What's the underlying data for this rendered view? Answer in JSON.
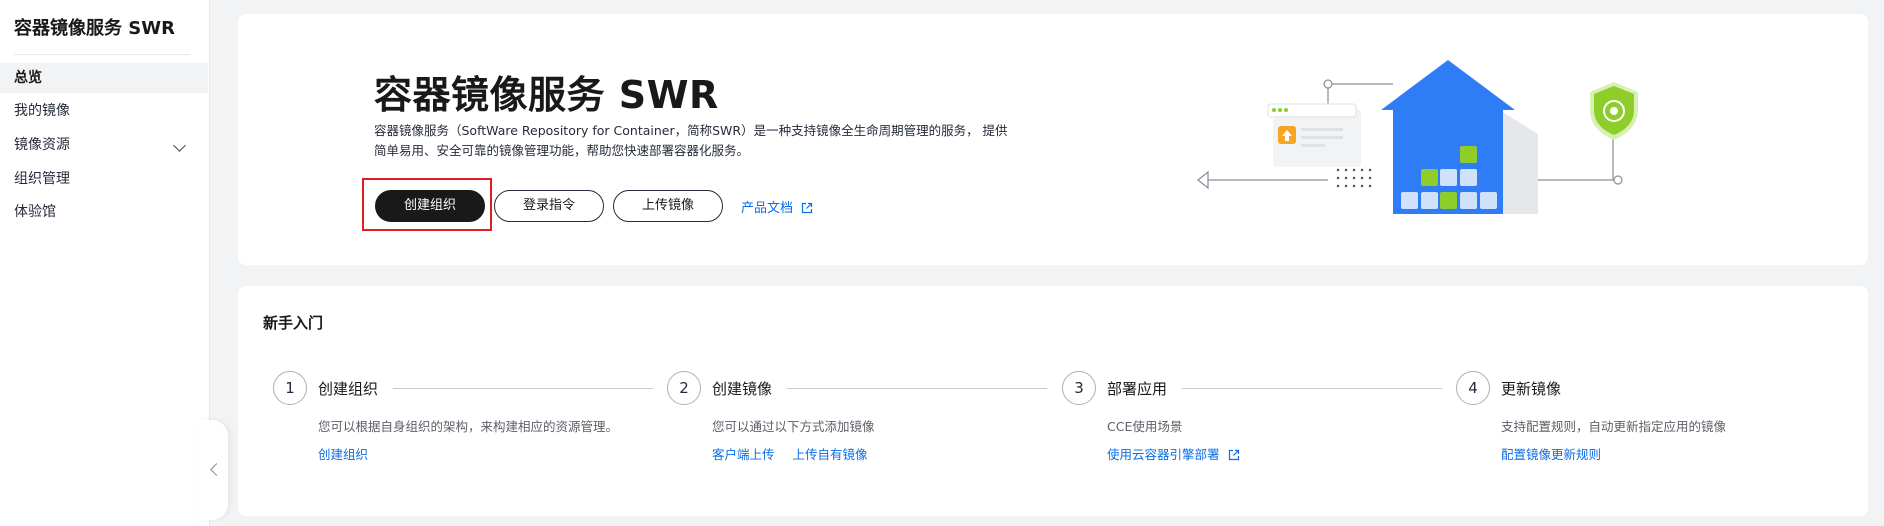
{
  "sidebar": {
    "title": "容器镜像服务 SWR",
    "items": [
      {
        "label": "总览",
        "active": true
      },
      {
        "label": "我的镜像"
      },
      {
        "label": "镜像资源",
        "expandable": true
      },
      {
        "label": "组织管理"
      },
      {
        "label": "体验馆"
      }
    ]
  },
  "hero": {
    "title": "容器镜像服务 SWR",
    "description": "容器镜像服务（SoftWare Repository for Container，简称SWR）是一种支持镜像全生命周期管理的服务， 提供简单易用、安全可靠的镜像管理功能，帮助您快速部署容器化服务。",
    "buttons": {
      "create_org": "创建组织",
      "login_cmd": "登录指令",
      "upload_image": "上传镜像"
    },
    "doc_link": "产品文档"
  },
  "guide": {
    "title": "新手入门",
    "steps": [
      {
        "num": "1",
        "title": "创建组织",
        "desc": "您可以根据自身组织的架构，来构建相应的资源管理。",
        "links": [
          "创建组织"
        ]
      },
      {
        "num": "2",
        "title": "创建镜像",
        "desc": "您可以通过以下方式添加镜像",
        "links": [
          "客户端上传",
          "上传自有镜像"
        ]
      },
      {
        "num": "3",
        "title": "部署应用",
        "desc": "CCE使用场景",
        "links": [
          "使用云容器引擎部署"
        ],
        "external": true
      },
      {
        "num": "4",
        "title": "更新镜像",
        "desc": "支持配置规则，自动更新指定应用的镜像",
        "links": [
          "配置镜像更新规则"
        ]
      }
    ]
  },
  "colors": {
    "primary_button": "#191919",
    "link": "#0b6fe6",
    "house_blue": "#2f7df6",
    "accent_green": "#8fcd2a",
    "highlight_red": "#e01e1e"
  }
}
